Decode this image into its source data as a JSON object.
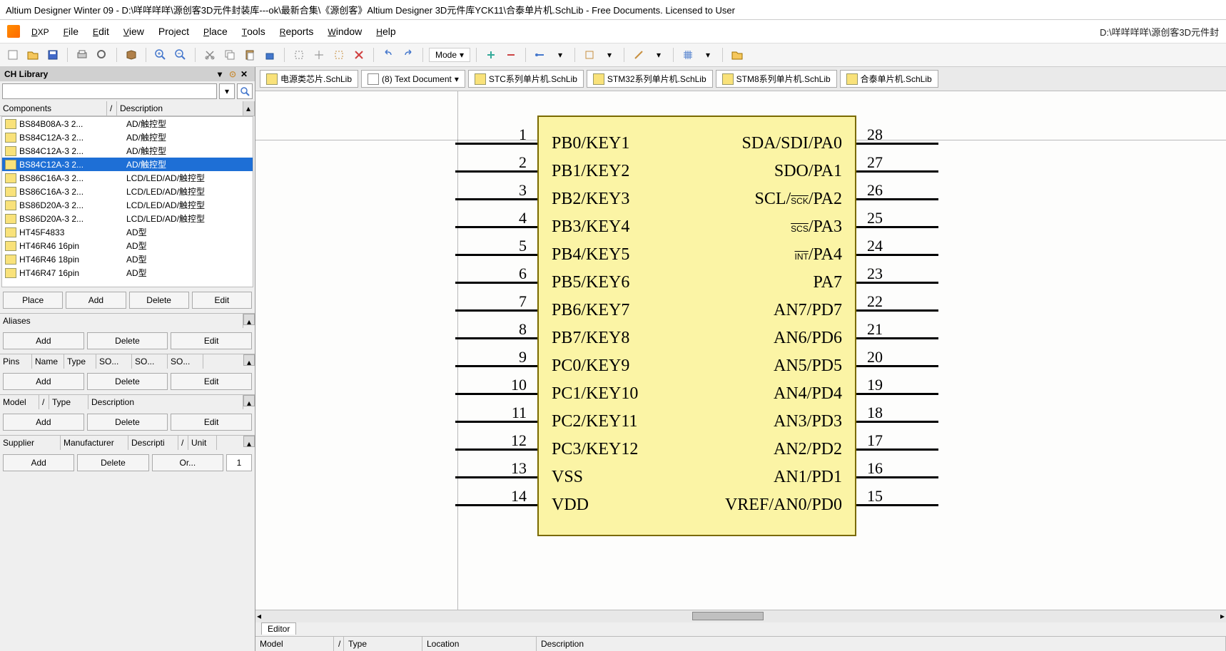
{
  "titlebar": "Altium Designer Winter 09 - D:\\咩咩咩咩\\源创客3D元件封装库---ok\\最新合集\\《源创客》Altium Designer 3D元件库YCK11\\合泰单片机.SchLib - Free Documents. Licensed to User",
  "path_right": "D:\\咩咩咩咩\\源创客3D元件封",
  "menu": {
    "dxp": "DXP",
    "file": "File",
    "edit": "Edit",
    "view": "View",
    "project": "Project",
    "place": "Place",
    "tools": "Tools",
    "reports": "Reports",
    "window": "Window",
    "help": "Help"
  },
  "toolbar_mode": "Mode",
  "panel_title": "CH Library",
  "comp_headers": {
    "name": "Components",
    "sort": "/",
    "desc": "Description"
  },
  "components": [
    {
      "name": "BS84B08A-3 2...",
      "desc": "AD/触控型"
    },
    {
      "name": "BS84C12A-3 2...",
      "desc": "AD/触控型"
    },
    {
      "name": "BS84C12A-3 2...",
      "desc": "AD/触控型"
    },
    {
      "name": "BS84C12A-3 2...",
      "desc": "AD/触控型"
    },
    {
      "name": "BS86C16A-3 2...",
      "desc": "LCD/LED/AD/触控型"
    },
    {
      "name": "BS86C16A-3 2...",
      "desc": "LCD/LED/AD/触控型"
    },
    {
      "name": "BS86D20A-3 2...",
      "desc": "LCD/LED/AD/触控型"
    },
    {
      "name": "BS86D20A-3 2...",
      "desc": "LCD/LED/AD/触控型"
    },
    {
      "name": "HT45F4833",
      "desc": "AD型"
    },
    {
      "name": "HT46R46 16pin",
      "desc": "AD型"
    },
    {
      "name": "HT46R46 18pin",
      "desc": "AD型"
    },
    {
      "name": "HT46R47 16pin",
      "desc": "AD型"
    }
  ],
  "selected_index": 3,
  "btns": {
    "place": "Place",
    "add": "Add",
    "delete": "Delete",
    "edit": "Edit",
    "or": "Or..."
  },
  "aliases_label": "Aliases",
  "pins_headers": {
    "pins": "Pins",
    "name": "Name",
    "type": "Type",
    "so1": "SO...",
    "so2": "SO...",
    "so3": "SO..."
  },
  "model_headers": {
    "model": "Model",
    "sort": "/",
    "type": "Type",
    "desc": "Description"
  },
  "supplier_headers": {
    "supplier": "Supplier",
    "manuf": "Manufacturer",
    "desc": "Descripti",
    "sort": "/",
    "unit": "Unit"
  },
  "stepper_value": "1",
  "doc_tabs": [
    {
      "label": "电源类芯片.SchLib",
      "icon": "lib"
    },
    {
      "label": "(8) Text Document",
      "icon": "txt",
      "dropdown": true
    },
    {
      "label": "STC系列单片机.SchLib",
      "icon": "lib"
    },
    {
      "label": "STM32系列单片机.SchLib",
      "icon": "lib"
    },
    {
      "label": "STM8系列单片机.SchLib",
      "icon": "lib"
    },
    {
      "label": "合泰单片机.SchLib",
      "icon": "lib"
    }
  ],
  "chip": {
    "left_pins": [
      {
        "num": "1",
        "label": "PB0/KEY1"
      },
      {
        "num": "2",
        "label": "PB1/KEY2"
      },
      {
        "num": "3",
        "label": "PB2/KEY3"
      },
      {
        "num": "4",
        "label": "PB3/KEY4"
      },
      {
        "num": "5",
        "label": "PB4/KEY5"
      },
      {
        "num": "6",
        "label": "PB5/KEY6"
      },
      {
        "num": "7",
        "label": "PB6/KEY7"
      },
      {
        "num": "8",
        "label": "PB7/KEY8"
      },
      {
        "num": "9",
        "label": "PC0/KEY9"
      },
      {
        "num": "10",
        "label": "PC1/KEY10"
      },
      {
        "num": "11",
        "label": "PC2/KEY11"
      },
      {
        "num": "12",
        "label": "PC3/KEY12"
      },
      {
        "num": "13",
        "label": "VSS"
      },
      {
        "num": "14",
        "label": "VDD"
      }
    ],
    "right_pins": [
      {
        "num": "28",
        "label": "SDA/SDI/PA0"
      },
      {
        "num": "27",
        "label": "SDO/PA1"
      },
      {
        "num": "26",
        "label_html": "SCL/<span class='overline'>SCK</span>/PA2"
      },
      {
        "num": "25",
        "label_html": "<span class='overline'>SCS</span>/PA3"
      },
      {
        "num": "24",
        "label_html": "<span class='overline'>INT</span>/PA4"
      },
      {
        "num": "23",
        "label": "PA7"
      },
      {
        "num": "22",
        "label": "AN7/PD7"
      },
      {
        "num": "21",
        "label": "AN6/PD6"
      },
      {
        "num": "20",
        "label": "AN5/PD5"
      },
      {
        "num": "19",
        "label": "AN4/PD4"
      },
      {
        "num": "18",
        "label": "AN3/PD3"
      },
      {
        "num": "17",
        "label": "AN2/PD2"
      },
      {
        "num": "16",
        "label": "AN1/PD1"
      },
      {
        "num": "15",
        "label": "VREF/AN0/PD0"
      }
    ]
  },
  "bottom_tab": "Editor",
  "bottom_cols": {
    "model": "Model",
    "sort": "/",
    "type": "Type",
    "location": "Location",
    "desc": "Description"
  }
}
